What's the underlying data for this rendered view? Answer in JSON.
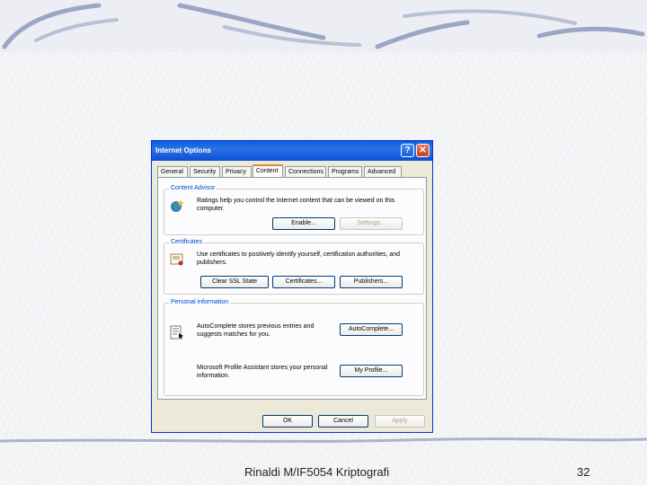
{
  "dialog": {
    "title": "Internet Options",
    "help_glyph": "?",
    "close_glyph": "✕",
    "tabs": [
      "General",
      "Security",
      "Privacy",
      "Content",
      "Connections",
      "Programs",
      "Advanced"
    ],
    "active_tab": "Content",
    "content_advisor": {
      "label": "Content Advisor",
      "text": "Ratings help you control the Internet content that can be viewed on this computer.",
      "enable_button": "Enable...",
      "settings_button": "Settings..."
    },
    "certificates": {
      "label": "Certificates",
      "text": "Use certificates to positively identify yourself, certification authorities, and publishers.",
      "clear_ssl_button": "Clear SSL State",
      "certificates_button": "Certificates...",
      "publishers_button": "Publishers..."
    },
    "personal_information": {
      "label": "Personal information",
      "autocomplete_text": "AutoComplete stores previous entries and suggests matches for you.",
      "autocomplete_button": "AutoComplete...",
      "profile_text": "Microsoft Profile Assistant stores your personal information.",
      "profile_button": "My Profile..."
    },
    "ok_button": "OK",
    "cancel_button": "Cancel",
    "apply_button": "Apply"
  },
  "footer": {
    "text": "Rinaldi M/IF5054 Kriptografi",
    "page_number": "32"
  },
  "colors": {
    "titlebar": "#0a5fd8",
    "group_label": "#0046d5",
    "active_tab_highlight": "#e68b2c"
  }
}
